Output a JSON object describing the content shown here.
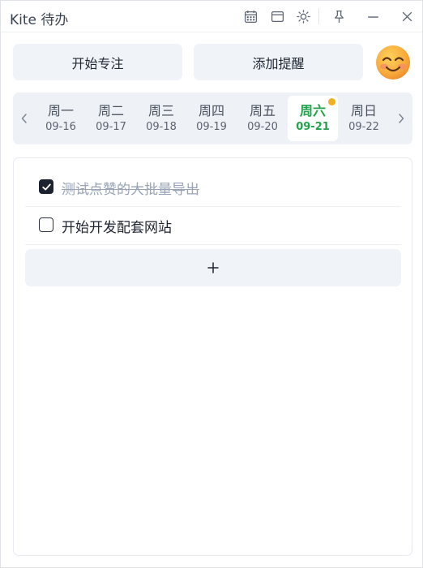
{
  "window": {
    "title": "Kite 待办",
    "icons": [
      "calendar-icon",
      "window-icon",
      "sun-icon",
      "pin-icon",
      "minimize-icon",
      "close-icon"
    ]
  },
  "actions": {
    "focus_label": "开始专注",
    "reminder_label": "添加提醒",
    "avatar_icon": "smiling-face-emoji"
  },
  "week": {
    "prev_icon": "chevron-left-icon",
    "next_icon": "chevron-right-icon",
    "days": [
      {
        "name": "周一",
        "date": "09-16"
      },
      {
        "name": "周二",
        "date": "09-17"
      },
      {
        "name": "周三",
        "date": "09-18"
      },
      {
        "name": "周四",
        "date": "09-19"
      },
      {
        "name": "周五",
        "date": "09-20"
      },
      {
        "name": "周六",
        "date": "09-21"
      },
      {
        "name": "周日",
        "date": "09-22"
      }
    ],
    "selected_index": 5,
    "marked_index": 5
  },
  "tasks": [
    {
      "text": "测试点赞的大批量导出",
      "done": true
    },
    {
      "text": "开始开发配套网站",
      "done": false
    }
  ],
  "add_icon": "plus-icon",
  "colors": {
    "accent": "#1fa34a",
    "dot": "#f2b01e",
    "checked": "#1d2230",
    "done_text": "#98a4b6"
  }
}
